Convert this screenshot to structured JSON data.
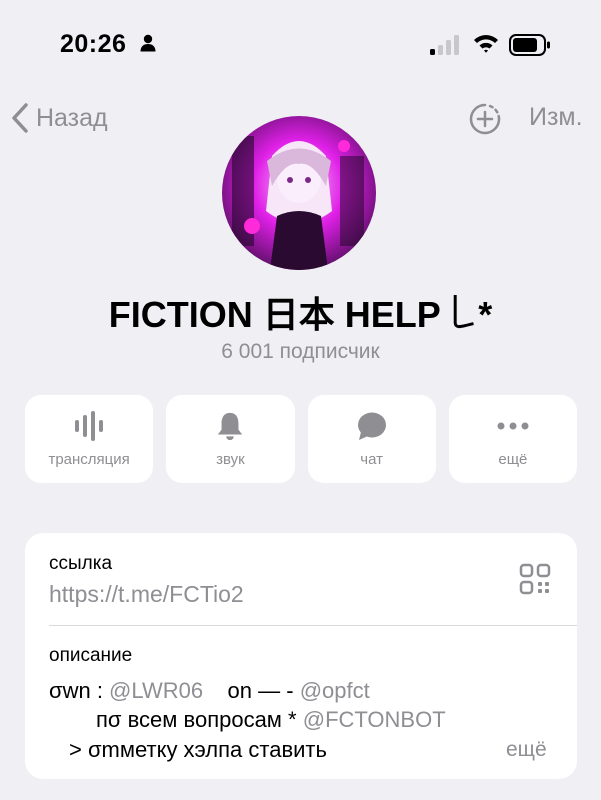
{
  "status": {
    "time": "20:26"
  },
  "nav": {
    "back_label": "Назад",
    "edit_label": "Изм."
  },
  "channel": {
    "title": "FICTION 日本 HELP ꒒*",
    "subscribers": "6 001 подписчик",
    "avatar_colors": [
      "#e020e8",
      "#8a1a9e",
      "#2a0a30"
    ]
  },
  "actions": [
    {
      "label": "трансляция",
      "icon": "live-stream-icon"
    },
    {
      "label": "звук",
      "icon": "bell-icon"
    },
    {
      "label": "чат",
      "icon": "chat-bubble-icon"
    },
    {
      "label": "ещё",
      "icon": "more-dots-icon"
    }
  ],
  "info": {
    "link_caption": "ссылка",
    "link_value": "https://t.me/FCTio2",
    "description_caption": "описание",
    "line1_prefix": "σwn : ",
    "line1_mention1": "@LWR06",
    "line1_middle": "    on — - ",
    "line1_mention2": "@opfct",
    "line2_prefix": "пσ всем вопросам * ",
    "line2_mention": "@FCTONBOT",
    "line3": "> σmметку хэлпа ставить",
    "more_label": "ещё"
  },
  "colors": {
    "background": "#efeff4",
    "card": "#ffffff",
    "muted": "#8e8e93",
    "icon": "#8e8e93"
  }
}
